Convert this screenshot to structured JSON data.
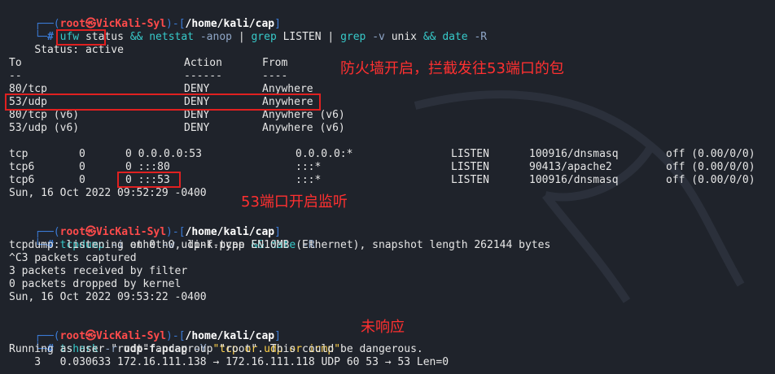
{
  "prompt": {
    "user": "root",
    "sep": "㉿",
    "host": "VicKali-Syl",
    "path": "/home/kali/cap",
    "hash": "#"
  },
  "cmd1": {
    "parts": [
      "ufw",
      "status",
      "&&",
      "netstat",
      "-anop",
      "|",
      "grep",
      "LISTEN",
      "|",
      "grep",
      "-v",
      "unix",
      "&&",
      "date",
      "-R"
    ]
  },
  "status": {
    "label": "Status:",
    "value": "active"
  },
  "ufw_table": {
    "headers": [
      "To",
      "Action",
      "From"
    ],
    "underline": [
      "--",
      "------",
      "----"
    ],
    "rows": [
      [
        "80/tcp",
        "DENY",
        "Anywhere"
      ],
      [
        "53/udp",
        "DENY",
        "Anywhere"
      ],
      [
        "80/tcp (v6)",
        "DENY",
        "Anywhere (v6)"
      ],
      [
        "53/udp (v6)",
        "DENY",
        "Anywhere (v6)"
      ]
    ]
  },
  "netstat": {
    "rows": [
      [
        "tcp",
        "0",
        "0 0.0.0.0:53",
        "0.0.0.0:*",
        "LISTEN",
        "100916/dnsmasq",
        "off (0.00/0/0)"
      ],
      [
        "tcp6",
        "0",
        "0 :::80",
        ":::*",
        "LISTEN",
        "90413/apache2",
        "off (0.00/0/0)"
      ],
      [
        "tcp6",
        "0",
        "0 :::53",
        ":::*",
        "LISTEN",
        "100916/dnsmasq",
        "off (0.00/0/0)"
      ]
    ]
  },
  "date1": "Sun, 16 Oct 2022 09:52:29 -0400",
  "cmd2": {
    "parts": [
      "tcpdump",
      "-i",
      "eth0",
      "-w",
      "udp-f.pcap",
      "&&",
      "date",
      "-R"
    ]
  },
  "tcpdump_out": [
    "tcpdump: listening on eth0, link-type EN10MB (Ethernet), snapshot length 262144 bytes",
    "^C3 packets captured",
    "3 packets received by filter",
    "0 packets dropped by kernel",
    "Sun, 16 Oct 2022 09:53:22 -0400"
  ],
  "cmd3": {
    "parts": [
      "tshark",
      "-r",
      "udp-f.pcap",
      "-Y",
      "\"tcp or udp or icmp\""
    ]
  },
  "tshark_out": [
    "Running as user \"root\" and group \"root\". This could be dangerous.",
    "    3   0.030633 172.16.111.138 → 172.16.111.118 UDP 60 53 → 53 Len=0"
  ],
  "annotations": {
    "firewall": "防火墙开启，拦截发往53端口的包",
    "listening": "53端口开启监听",
    "no_response": "未响应"
  },
  "colors": {
    "background": "#1f232b",
    "prompt_blue": "#3b7bd6",
    "prompt_red": "#ff4b4b",
    "highlight_box": "#e02020"
  }
}
